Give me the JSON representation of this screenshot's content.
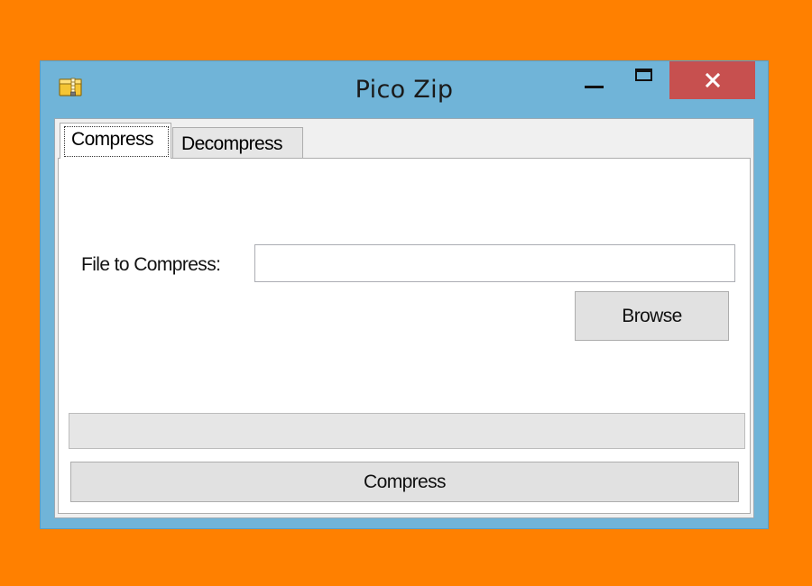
{
  "window": {
    "title": "Pico Zip",
    "icon": "folder-zip-icon",
    "controls": {
      "minimize_icon": "minimize-icon",
      "maximize_icon": "maximize-icon",
      "close_icon": "close-icon",
      "close_glyph": "✕"
    }
  },
  "tabs": [
    {
      "label": "Compress",
      "selected": true
    },
    {
      "label": "Decompress",
      "selected": false
    }
  ],
  "compress_tab": {
    "file_label": "File to Compress:",
    "file_input_value": "",
    "browse_label": "Browse",
    "progress_percent": 0,
    "compress_label": "Compress"
  },
  "colors": {
    "desktop_background": "#FF8000",
    "title_bar": "#70B4D8",
    "close_button": "#C7504F",
    "progress_fill": "#06B025"
  }
}
